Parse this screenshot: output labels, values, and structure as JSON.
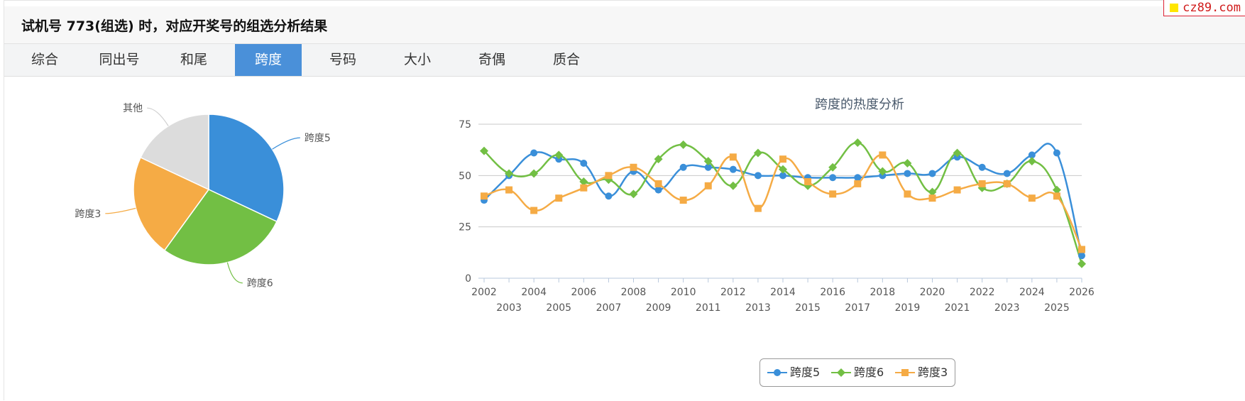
{
  "watermark": "cz89.com",
  "page_title": "试机号 773(组选) 时，对应开奖号的组选分析结果",
  "tabs": [
    {
      "label": "综合"
    },
    {
      "label": "同出号"
    },
    {
      "label": "和尾"
    },
    {
      "label": "跨度",
      "active": true
    },
    {
      "label": "号码"
    },
    {
      "label": "大小"
    },
    {
      "label": "奇偶"
    },
    {
      "label": "质合"
    }
  ],
  "colors": {
    "s5": "#3a8fd9",
    "s6": "#72bf44",
    "s3": "#f5ab45",
    "other": "#dcdcdc",
    "tab_active": "#4a90d9"
  },
  "chart_data": [
    {
      "type": "pie",
      "title": "",
      "slices": [
        {
          "label": "跨度5",
          "value": 32,
          "color": "#3a8fd9"
        },
        {
          "label": "跨度6",
          "value": 28,
          "color": "#72bf44"
        },
        {
          "label": "跨度3",
          "value": 22,
          "color": "#f5ab45"
        },
        {
          "label": "其他",
          "value": 18,
          "color": "#dcdcdc"
        }
      ]
    },
    {
      "type": "line",
      "title": "跨度的热度分析",
      "xlabel": "",
      "ylabel": "",
      "ylim": [
        0,
        75
      ],
      "yticks": [
        0,
        25,
        50,
        75
      ],
      "grid": true,
      "legend_position": "bottom",
      "x": [
        "2002",
        "2003",
        "2004",
        "2005",
        "2006",
        "2007",
        "2008",
        "2009",
        "2010",
        "2011",
        "2012",
        "2013",
        "2014",
        "2015",
        "2016",
        "2017",
        "2018",
        "2019",
        "2020",
        "2021",
        "2022",
        "2023",
        "2024",
        "2025",
        "2026"
      ],
      "series": [
        {
          "name": "跨度5",
          "color": "#3a8fd9",
          "marker": "circle",
          "values": [
            38,
            50,
            61,
            58,
            56,
            40,
            52,
            43,
            54,
            54,
            53,
            50,
            50,
            49,
            49,
            49,
            50,
            51,
            51,
            59,
            54,
            51,
            60,
            61,
            11
          ]
        },
        {
          "name": "跨度6",
          "color": "#72bf44",
          "marker": "diamond",
          "values": [
            62,
            51,
            51,
            60,
            47,
            48,
            41,
            58,
            65,
            57,
            45,
            61,
            53,
            45,
            54,
            66,
            52,
            56,
            42,
            61,
            44,
            46,
            57,
            43,
            7
          ]
        },
        {
          "name": "跨度3",
          "color": "#f5ab45",
          "marker": "square",
          "values": [
            40,
            43,
            33,
            39,
            44,
            50,
            54,
            46,
            38,
            45,
            59,
            34,
            58,
            47,
            41,
            46,
            60,
            41,
            39,
            43,
            46,
            46,
            39,
            40,
            14
          ]
        }
      ]
    }
  ]
}
